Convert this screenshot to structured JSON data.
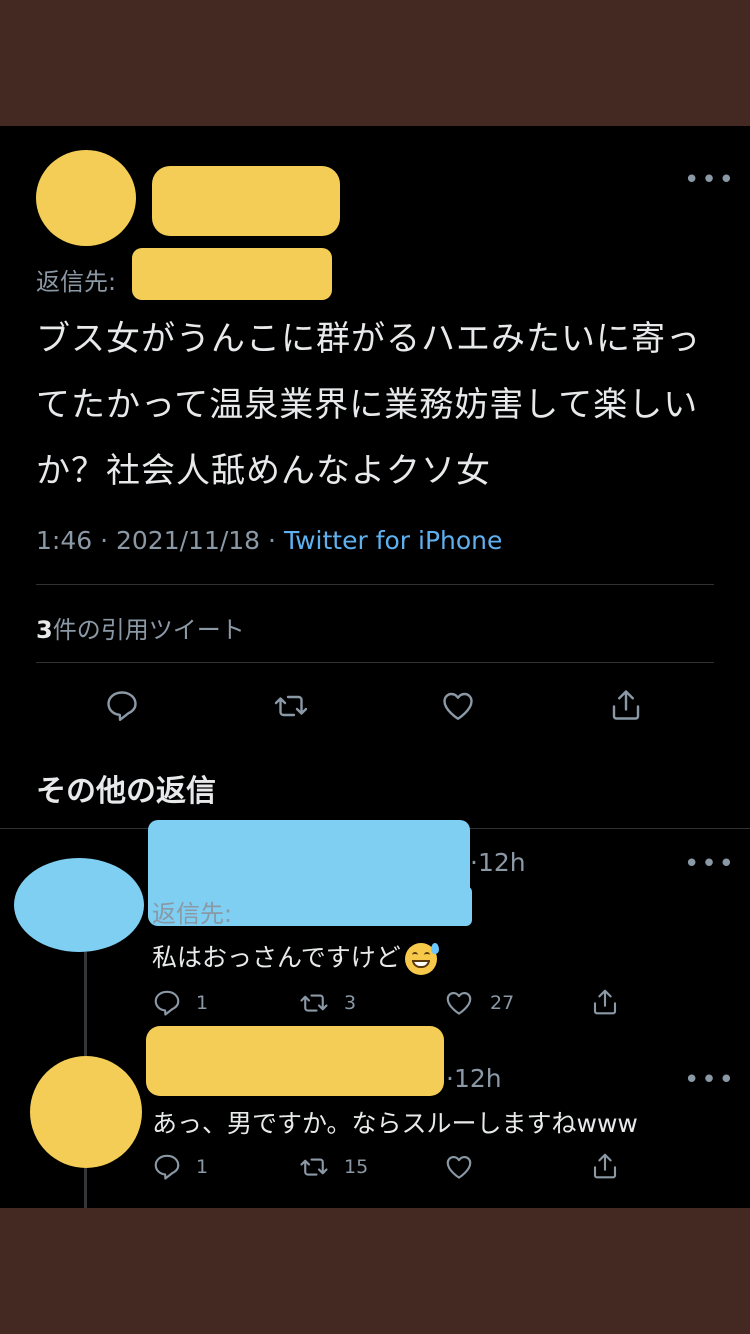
{
  "tweet": {
    "reply_to_label": "返信先:",
    "body": "ブス女がうんこに群がるハエみたいに寄ってたかって温泉業界に業務妨害して楽しいか？社会人舐めんなよクソ女",
    "time": "1:46",
    "date": "2021/11/18",
    "source": "Twitter for iPhone",
    "quote_count": "3",
    "quote_label": "件の引用ツイート"
  },
  "replies_section": {
    "title": "その他の返信"
  },
  "replies": [
    {
      "time": "12h",
      "reply_to_label": "返信先:",
      "text": "私はおっさんですけど",
      "reply_count": "1",
      "retweet_count": "3",
      "like_count": "27"
    },
    {
      "time": "12h",
      "text": "あっ、男ですか。ならスルーしますねwww",
      "reply_count": "1",
      "retweet_count": "15"
    }
  ],
  "colors": {
    "background_frame": "#432922",
    "screen": "#000000",
    "link": "#5fb0ef",
    "muted": "#8b98a5",
    "redaction_yellow": "#f3cd55",
    "redaction_blue": "#7fcff2"
  },
  "icons": [
    "more-icon",
    "reply-icon",
    "retweet-icon",
    "like-icon",
    "share-icon",
    "sweat-smile-emoji"
  ]
}
